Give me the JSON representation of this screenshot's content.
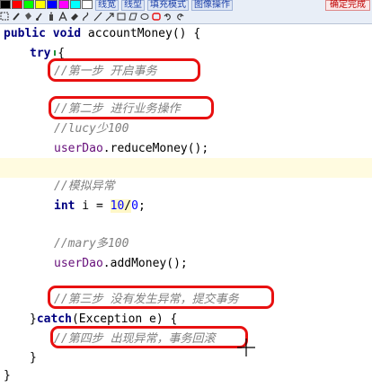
{
  "toolbar": {
    "colors": [
      "#000000",
      "#ff0000",
      "#00ff00",
      "#ffff00",
      "#0000ff",
      "#ff00ff",
      "#00ffff",
      "#ffffff"
    ],
    "menu": [
      "线宽",
      "线型",
      "填充模式",
      "图像操作"
    ],
    "confirm_label": "确定完成",
    "tools": [
      "select-icon",
      "pencil-icon",
      "bucket-icon",
      "brush-icon",
      "spray-icon",
      "text-icon",
      "eraser-icon",
      "curve-icon",
      "line-icon",
      "arrow-icon",
      "rectangle-icon",
      "polygon-icon",
      "ellipse-icon",
      "rounded-rect-icon",
      "undo-icon",
      "redo-icon"
    ]
  },
  "code": {
    "l1_kw": "public void",
    "l1_rest": " accountMoney() {",
    "try": "try",
    "brace_open": " {",
    "c1": "//第一步 开启事务",
    "c2": "//第二步 进行业务操作",
    "c3": "//lucy少100",
    "field1": "userDao",
    "call1": ".reduceMoney();",
    "c4": "//模拟异常",
    "int_kw": "int",
    "assign": " i = ",
    "num": "10",
    "div": "/",
    "zero": "0",
    "semi": ";",
    "c5": "//mary多100",
    "field2": "userDao",
    "call2": ".addMoney();",
    "c6": "//第三步 没有发生异常，提交事务",
    "close_try": "}",
    "catch_kw": "catch",
    "catch_rest": "(Exception e) {",
    "c7": "//第四步 出现异常，事务回滚",
    "close_catch": "}",
    "close_method": "}"
  }
}
